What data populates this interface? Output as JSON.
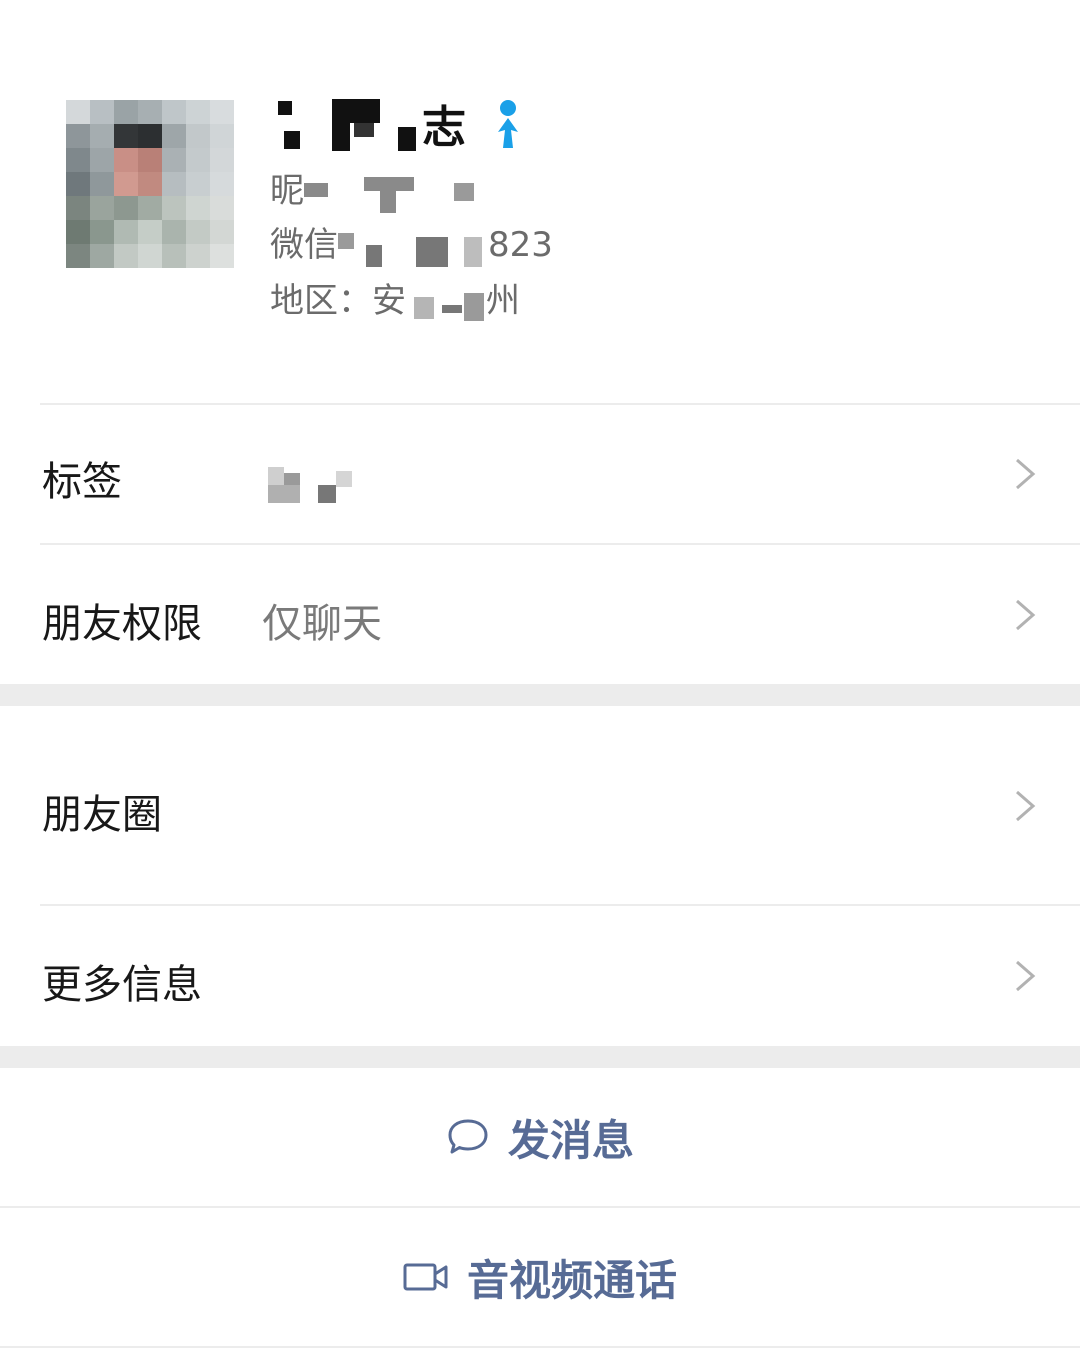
{
  "profile": {
    "name_visible": "志",
    "nickname_prefix": "昵",
    "wechat_id_prefix": "微信",
    "wechat_id_suffix": "823",
    "region_label": "地区：",
    "region_start": "安",
    "region_end": "州",
    "gender_icon": "male-icon",
    "gender_color": "#1aa0e8"
  },
  "rows": {
    "tags": {
      "label": "标签"
    },
    "permissions": {
      "label": "朋友权限",
      "value": "仅聊天"
    },
    "moments": {
      "label": "朋友圈"
    },
    "more_info": {
      "label": "更多信息"
    }
  },
  "actions": {
    "message": {
      "label": "发消息",
      "icon": "chat-bubble-icon"
    },
    "call": {
      "label": "音视频通话",
      "icon": "video-camera-icon"
    }
  },
  "colors": {
    "link": "#576b95",
    "separator": "#ececec",
    "secondary_text": "#7a7a7a"
  }
}
